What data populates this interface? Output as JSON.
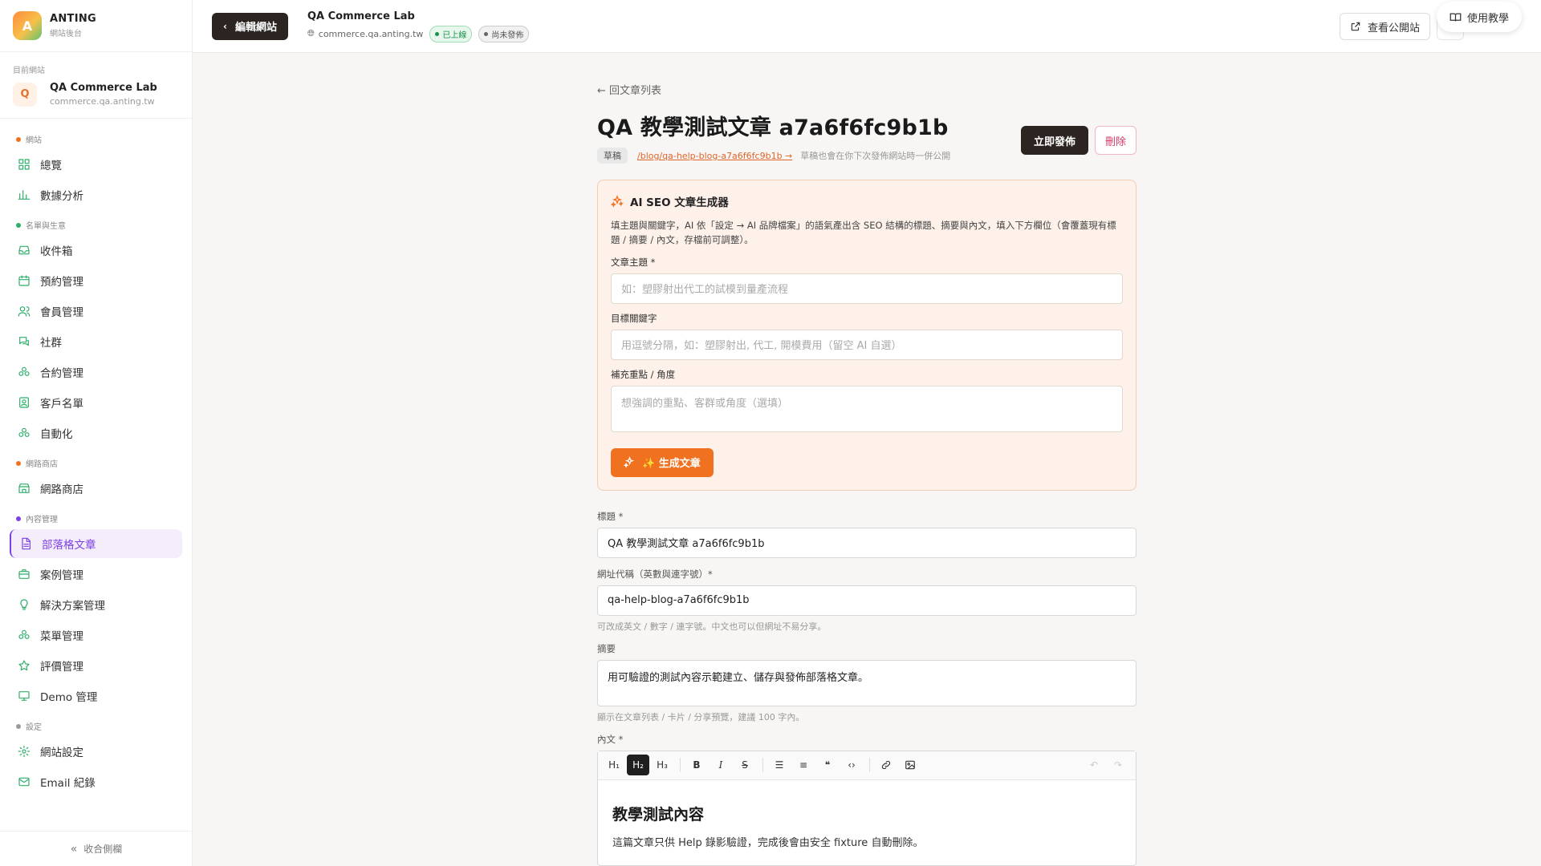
{
  "brand": {
    "logo_letter": "A",
    "name": "ANTING",
    "subtitle": "網站後台"
  },
  "current_site": {
    "label": "目前網站",
    "avatar_letter": "Q",
    "name": "QA Commerce Lab",
    "domain": "commerce.qa.anting.tw"
  },
  "nav": {
    "sections": [
      {
        "title": "網站",
        "dot_color": "#f0711f",
        "items": [
          {
            "label": "總覽",
            "icon": "grid-icon"
          },
          {
            "label": "數據分析",
            "icon": "chart-icon"
          }
        ]
      },
      {
        "title": "名單與生意",
        "dot_color": "#2fae6a",
        "items": [
          {
            "label": "收件箱",
            "icon": "inbox-icon"
          },
          {
            "label": "預約管理",
            "icon": "calendar-icon"
          },
          {
            "label": "會員管理",
            "icon": "users-icon"
          },
          {
            "label": "社群",
            "icon": "chat-icon"
          },
          {
            "label": "合約管理",
            "icon": "cluster-icon"
          },
          {
            "label": "客戶名單",
            "icon": "contact-icon"
          },
          {
            "label": "自動化",
            "icon": "cluster-icon"
          }
        ]
      },
      {
        "title": "網路商店",
        "dot_color": "#f0711f",
        "items": [
          {
            "label": "網路商店",
            "icon": "store-icon"
          }
        ]
      },
      {
        "title": "內容管理",
        "dot_color": "#7b3fe4",
        "items": [
          {
            "label": "部落格文章",
            "icon": "document-icon",
            "active": true
          },
          {
            "label": "案例管理",
            "icon": "briefcase-icon"
          },
          {
            "label": "解決方案管理",
            "icon": "lightbulb-icon"
          },
          {
            "label": "菜單管理",
            "icon": "cluster-icon"
          },
          {
            "label": "評價管理",
            "icon": "star-icon"
          },
          {
            "label": "Demo 管理",
            "icon": "presentation-icon"
          }
        ]
      },
      {
        "title": "設定",
        "dot_color": "#999999",
        "items": [
          {
            "label": "網站設定",
            "icon": "gear-icon"
          },
          {
            "label": "Email 紀錄",
            "icon": "mail-icon"
          }
        ]
      }
    ],
    "collapse_label": "收合側欄"
  },
  "topbar": {
    "edit_site_label": "編輯網站",
    "site_title": "QA Commerce Lab",
    "site_domain": "commerce.qa.anting.tw",
    "status_live": "已上線",
    "status_unpublished": "尚未發佈",
    "view_public_label": "查看公開站",
    "help_label": "使用教學"
  },
  "article": {
    "back_label": "← 回文章列表",
    "title": "QA 教學測試文章 a7a6f6fc9b1b",
    "status_tag": "草稿",
    "slug_link": "/blog/qa-help-blog-a7a6f6fc9b1b →",
    "draft_note": "草稿也會在你下次發佈網站時一併公開",
    "publish_label": "立即發佈",
    "delete_label": "刪除"
  },
  "ai": {
    "title": "AI SEO 文章生成器",
    "description": "填主題與關鍵字，AI 依「設定 → AI 品牌檔案」的語氣產出含 SEO 結構的標題、摘要與內文，填入下方欄位（會覆蓋現有標題 / 摘要 / 內文，存檔前可調整）。",
    "topic_label": "文章主題 *",
    "topic_placeholder": "如：塑膠射出代工的試模到量產流程",
    "keywords_label": "目標關鍵字",
    "keywords_placeholder": "用逗號分隔，如：塑膠射出, 代工, 開模費用（留空 AI 自選）",
    "angle_label": "補充重點 / 角度",
    "angle_placeholder": "想強調的重點、客群或角度（選填）",
    "generate_label": "✨ 生成文章"
  },
  "form": {
    "title_label": "標題 *",
    "title_value": "QA 教學測試文章 a7a6f6fc9b1b",
    "slug_label": "網址代稱（英數與連字號）*",
    "slug_value": "qa-help-blog-a7a6f6fc9b1b",
    "slug_hint": "可改成英文 / 數字 / 連字號。中文也可以但網址不易分享。",
    "excerpt_label": "摘要",
    "excerpt_value": "用可驗證的測試內容示範建立、儲存與發佈部落格文章。",
    "excerpt_hint": "顯示在文章列表 / 卡片 / 分享預覽，建議 100 字內。",
    "body_label": "內文 *"
  },
  "editor": {
    "toolbar": {
      "h1": "H₁",
      "h2": "H₂",
      "h3": "H₃"
    },
    "heading": "教學測試內容",
    "paragraph": "這篇文章只供 Help 錄影驗證，完成後會由安全 fixture 自動刪除。"
  }
}
